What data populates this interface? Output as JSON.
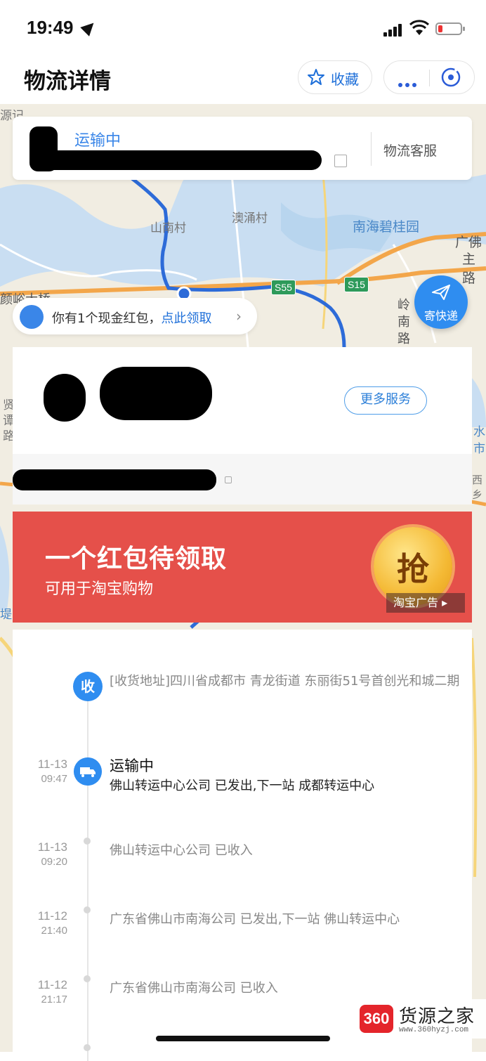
{
  "status_bar": {
    "time": "19:49"
  },
  "header": {
    "title": "物流详情",
    "favorite_label": "收藏"
  },
  "shipment": {
    "status": "运输中",
    "service_label": "物流客服"
  },
  "red_packet_pill": {
    "prefix": "你有1个现金红包，",
    "link": "点此领取",
    "chevron": "›"
  },
  "send_button": {
    "label": "寄快递"
  },
  "merchant": {
    "more_services": "更多服务"
  },
  "ad": {
    "title": "一个红包待领取",
    "subtitle": "可用于淘宝购物",
    "coin": "抢",
    "tag": "淘宝广告 ▸"
  },
  "map_labels": [
    "源记",
    "山南村",
    "澳涌村",
    "南海碧桂园",
    "广佛",
    "主路",
    "岭",
    "南",
    "路",
    "颜峪大桥",
    "贤",
    "谭",
    "路",
    "水",
    "市",
    "西乡",
    "堤"
  ],
  "road_badges": [
    "S55",
    "S15"
  ],
  "timeline": {
    "receiver": {
      "icon": "收",
      "address": "[收货地址]四川省成都市 青龙街道 东丽街51号首创光和城二期"
    },
    "events": [
      {
        "date": "11-13",
        "time": "09:47",
        "title": "运输中",
        "desc": "佛山转运中心公司 已发出,下一站 成都转运中心"
      },
      {
        "date": "11-13",
        "time": "09:20",
        "desc": "佛山转运中心公司 已收入"
      },
      {
        "date": "11-12",
        "time": "21:40",
        "desc": "广东省佛山市南海公司 已发出,下一站 佛山转运中心"
      },
      {
        "date": "11-12",
        "time": "21:17",
        "desc": "广东省佛山市南海公司 已收入"
      }
    ]
  },
  "watermark": {
    "logo": "360",
    "name": "货源之家",
    "url": "www.360hyzj.com"
  },
  "colors": {
    "accent": "#2f8df0",
    "link": "#1e6fd9",
    "ad_red": "#e5504a",
    "road_green": "#2e9a5a"
  }
}
